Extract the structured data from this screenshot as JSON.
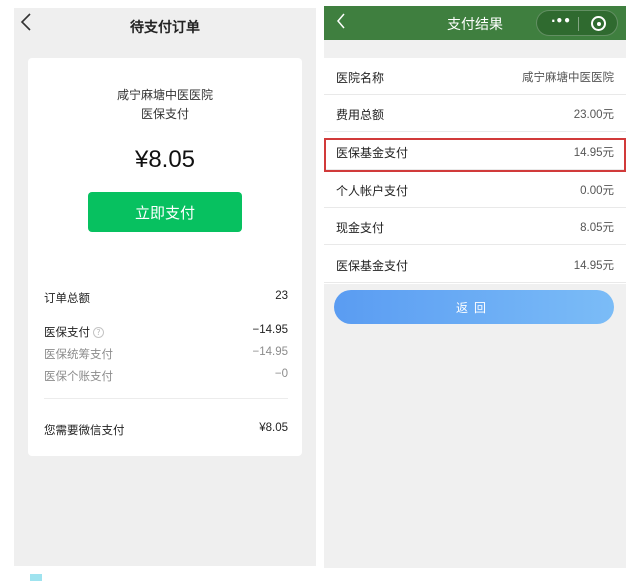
{
  "left": {
    "back_icon": "chevron-left-icon",
    "title": "待支付订单",
    "hospital": "咸宁麻塘中医医院",
    "pay_type": "医保支付",
    "amount": "¥8.05",
    "pay_button": "立即支付",
    "order_total_label": "订单总额",
    "order_total_value": "23",
    "insurance_label": "医保支付",
    "insurance_help_icon": "question-circle-icon",
    "insurance_value": "−14.95",
    "pooling_label": "医保统筹支付",
    "pooling_value": "−14.95",
    "personal_label": "医保个账支付",
    "personal_value": "−0",
    "wechat_label": "您需要微信支付",
    "wechat_value": "¥8.05"
  },
  "right": {
    "back_icon": "chevron-left-icon",
    "title": "支付结果",
    "more_icon": "more-dots-icon",
    "close_icon": "target-close-icon",
    "header_color": "#3f7f3f",
    "rows": [
      {
        "label": "医院名称",
        "value": "咸宁麻塘中医医院"
      },
      {
        "label": "费用总额",
        "value": "23.00元"
      },
      {
        "label": "医保基金支付",
        "value": "14.95元"
      },
      {
        "label": "个人帐户支付",
        "value": "0.00元"
      },
      {
        "label": "现金支付",
        "value": "8.05元"
      },
      {
        "label": "医保基金支付",
        "value": "14.95元"
      }
    ],
    "highlight_color": "#d13a3a",
    "back_button": "返回"
  }
}
